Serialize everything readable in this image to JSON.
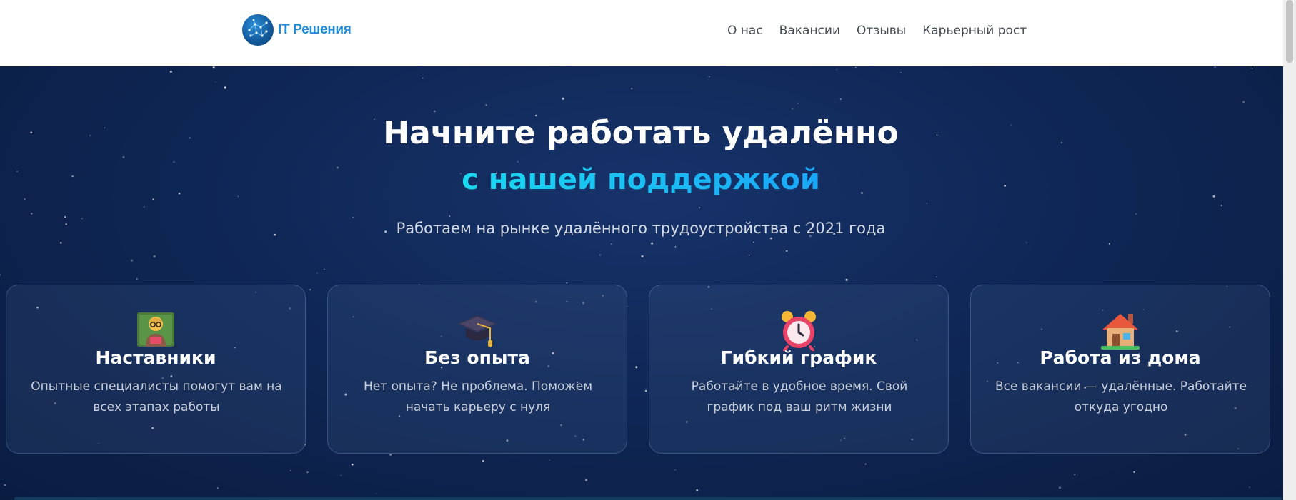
{
  "header": {
    "logo_text": "IT Решения",
    "logo_icon": "brain-network-icon",
    "nav": [
      {
        "label": "О нас"
      },
      {
        "label": "Вакансии"
      },
      {
        "label": "Отзывы"
      },
      {
        "label": "Карьерный рост"
      }
    ]
  },
  "hero": {
    "title": "Начните работать удалённо",
    "subtitle": "с нашей поддержкой",
    "lead": "Работаем на рынке удалённого трудоустройства с 2021 года",
    "cards": [
      {
        "icon": "teacher-icon",
        "title": "Наставники",
        "text": "Опытные специалисты помогут вам на всех этапах работы"
      },
      {
        "icon": "graduation-cap-icon",
        "title": "Без опыта",
        "text": "Нет опыта? Не проблема. Поможем начать карьеру с нуля"
      },
      {
        "icon": "alarm-clock-icon",
        "title": "Гибкий график",
        "text": "Работайте в удобное время. Свой график под ваш ритм жизни"
      },
      {
        "icon": "house-icon",
        "title": "Работа из дома",
        "text": "Все вакансии — удалённые. Работайте откуда угодно"
      }
    ]
  },
  "colors": {
    "header_bg": "#ffffff",
    "hero_bg": "#0f2756",
    "accent": "#1aa6f7",
    "logo": "#1f8ad6"
  }
}
